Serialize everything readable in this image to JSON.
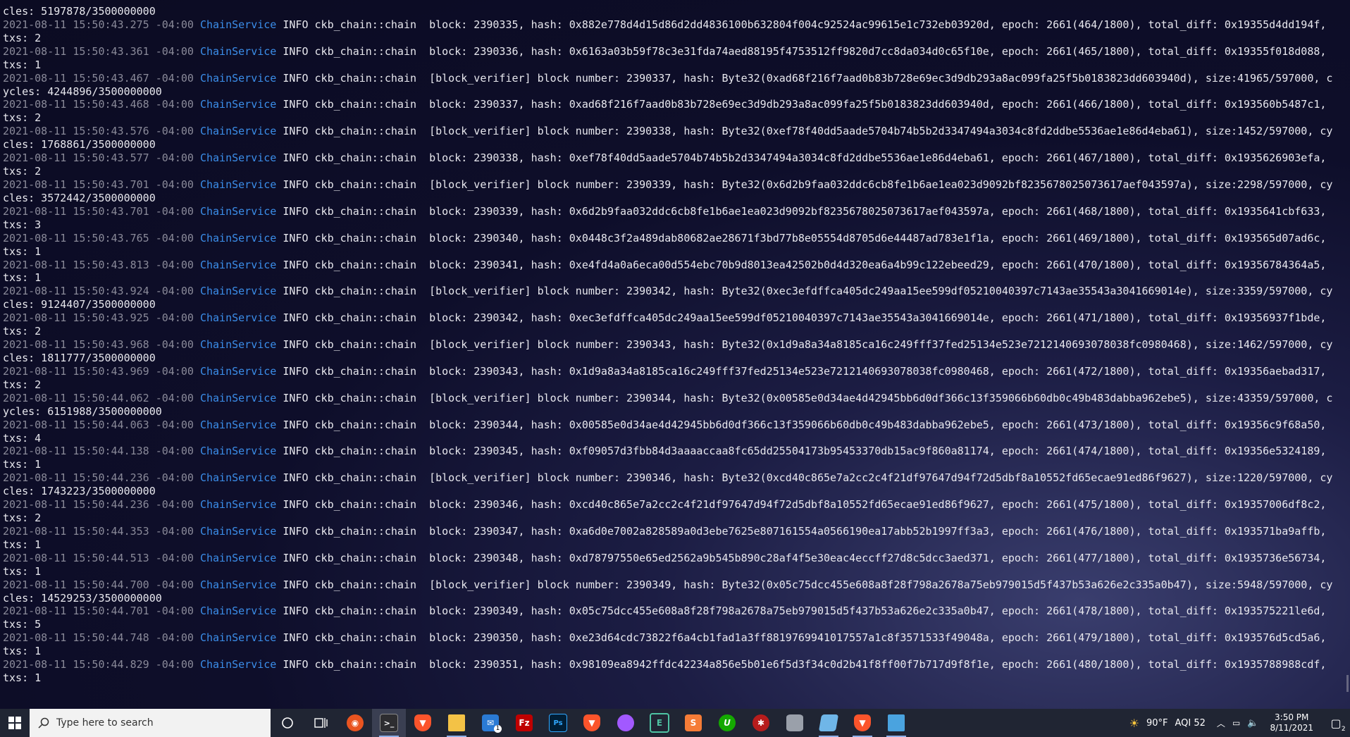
{
  "terminal": {
    "service_name": "ChainService",
    "lines": [
      {
        "text": "cles: 5197878/3500000000"
      },
      {
        "ts": "2021-08-11 15:50:43.275 -04:00",
        "msg": " INFO ckb_chain::chain  block: 2390335, hash: 0x882e778d4d15d86d2dd4836100b632804f004c92524ac99615e1c732eb03920d, epoch: 2661(464/1800), total_diff: 0x19355d4dd194f,"
      },
      {
        "text": "txs: 2"
      },
      {
        "ts": "2021-08-11 15:50:43.361 -04:00",
        "msg": " INFO ckb_chain::chain  block: 2390336, hash: 0x6163a03b59f78c3e31fda74aed88195f4753512ff9820d7cc8da034d0c65f10e, epoch: 2661(465/1800), total_diff: 0x19355f018d088,"
      },
      {
        "text": "txs: 1"
      },
      {
        "ts": "2021-08-11 15:50:43.467 -04:00",
        "msg": " INFO ckb_chain::chain  [block_verifier] block number: 2390337, hash: Byte32(0xad68f216f7aad0b83b728e69ec3d9db293a8ac099fa25f5b0183823dd603940d), size:41965/597000, c"
      },
      {
        "text": "ycles: 4244896/3500000000"
      },
      {
        "ts": "2021-08-11 15:50:43.468 -04:00",
        "msg": " INFO ckb_chain::chain  block: 2390337, hash: 0xad68f216f7aad0b83b728e69ec3d9db293a8ac099fa25f5b0183823dd603940d, epoch: 2661(466/1800), total_diff: 0x193560b5487c1,"
      },
      {
        "text": "txs: 2"
      },
      {
        "ts": "2021-08-11 15:50:43.576 -04:00",
        "msg": " INFO ckb_chain::chain  [block_verifier] block number: 2390338, hash: Byte32(0xef78f40dd5aade5704b74b5b2d3347494a3034c8fd2ddbe5536ae1e86d4eba61), size:1452/597000, cy"
      },
      {
        "text": "cles: 1768861/3500000000"
      },
      {
        "ts": "2021-08-11 15:50:43.577 -04:00",
        "msg": " INFO ckb_chain::chain  block: 2390338, hash: 0xef78f40dd5aade5704b74b5b2d3347494a3034c8fd2ddbe5536ae1e86d4eba61, epoch: 2661(467/1800), total_diff: 0x1935626903efa,"
      },
      {
        "text": "txs: 2"
      },
      {
        "ts": "2021-08-11 15:50:43.701 -04:00",
        "msg": " INFO ckb_chain::chain  [block_verifier] block number: 2390339, hash: Byte32(0x6d2b9faa032ddc6cb8fe1b6ae1ea023d9092bf8235678025073617aef043597a), size:2298/597000, cy"
      },
      {
        "text": "cles: 3572442/3500000000"
      },
      {
        "ts": "2021-08-11 15:50:43.701 -04:00",
        "msg": " INFO ckb_chain::chain  block: 2390339, hash: 0x6d2b9faa032ddc6cb8fe1b6ae1ea023d9092bf8235678025073617aef043597a, epoch: 2661(468/1800), total_diff: 0x1935641cbf633,"
      },
      {
        "text": "txs: 3"
      },
      {
        "ts": "2021-08-11 15:50:43.765 -04:00",
        "msg": " INFO ckb_chain::chain  block: 2390340, hash: 0x0448c3f2a489dab80682ae28671f3bd77b8e05554d8705d6e44487ad783e1f1a, epoch: 2661(469/1800), total_diff: 0x193565d07ad6c,"
      },
      {
        "text": "txs: 1"
      },
      {
        "ts": "2021-08-11 15:50:43.813 -04:00",
        "msg": " INFO ckb_chain::chain  block: 2390341, hash: 0xe4fd4a0a6eca00d554ebc70b9d8013ea42502b0d4d320ea6a4b99c122ebeed29, epoch: 2661(470/1800), total_diff: 0x19356784364a5,"
      },
      {
        "text": "txs: 1"
      },
      {
        "ts": "2021-08-11 15:50:43.924 -04:00",
        "msg": " INFO ckb_chain::chain  [block_verifier] block number: 2390342, hash: Byte32(0xec3efdffca405dc249aa15ee599df05210040397c7143ae35543a3041669014e), size:3359/597000, cy"
      },
      {
        "text": "cles: 9124407/3500000000"
      },
      {
        "ts": "2021-08-11 15:50:43.925 -04:00",
        "msg": " INFO ckb_chain::chain  block: 2390342, hash: 0xec3efdffca405dc249aa15ee599df05210040397c7143ae35543a3041669014e, epoch: 2661(471/1800), total_diff: 0x19356937f1bde,"
      },
      {
        "text": "txs: 2"
      },
      {
        "ts": "2021-08-11 15:50:43.968 -04:00",
        "msg": " INFO ckb_chain::chain  [block_verifier] block number: 2390343, hash: Byte32(0x1d9a8a34a8185ca16c249fff37fed25134e523e7212140693078038fc0980468), size:1462/597000, cy"
      },
      {
        "text": "cles: 1811777/3500000000"
      },
      {
        "ts": "2021-08-11 15:50:43.969 -04:00",
        "msg": " INFO ckb_chain::chain  block: 2390343, hash: 0x1d9a8a34a8185ca16c249fff37fed25134e523e7212140693078038fc0980468, epoch: 2661(472/1800), total_diff: 0x19356aebad317,"
      },
      {
        "text": "txs: 2"
      },
      {
        "ts": "2021-08-11 15:50:44.062 -04:00",
        "msg": " INFO ckb_chain::chain  [block_verifier] block number: 2390344, hash: Byte32(0x00585e0d34ae4d42945bb6d0df366c13f359066b60db0c49b483dabba962ebe5), size:43359/597000, c"
      },
      {
        "text": "ycles: 6151988/3500000000"
      },
      {
        "ts": "2021-08-11 15:50:44.063 -04:00",
        "msg": " INFO ckb_chain::chain  block: 2390344, hash: 0x00585e0d34ae4d42945bb6d0df366c13f359066b60db0c49b483dabba962ebe5, epoch: 2661(473/1800), total_diff: 0x19356c9f68a50,"
      },
      {
        "text": "txs: 4"
      },
      {
        "ts": "2021-08-11 15:50:44.138 -04:00",
        "msg": " INFO ckb_chain::chain  block: 2390345, hash: 0xf09057d3fbb84d3aaaaccaa8fc65dd25504173b95453370db15ac9f860a81174, epoch: 2661(474/1800), total_diff: 0x19356e5324189,"
      },
      {
        "text": "txs: 1"
      },
      {
        "ts": "2021-08-11 15:50:44.236 -04:00",
        "msg": " INFO ckb_chain::chain  [block_verifier] block number: 2390346, hash: Byte32(0xcd40c865e7a2cc2c4f21df97647d94f72d5dbf8a10552fd65ecae91ed86f9627), size:1220/597000, cy"
      },
      {
        "text": "cles: 1743223/3500000000"
      },
      {
        "ts": "2021-08-11 15:50:44.236 -04:00",
        "msg": " INFO ckb_chain::chain  block: 2390346, hash: 0xcd40c865e7a2cc2c4f21df97647d94f72d5dbf8a10552fd65ecae91ed86f9627, epoch: 2661(475/1800), total_diff: 0x19357006df8c2,"
      },
      {
        "text": "txs: 2"
      },
      {
        "ts": "2021-08-11 15:50:44.353 -04:00",
        "msg": " INFO ckb_chain::chain  block: 2390347, hash: 0xa6d0e7002a828589a0d3ebe7625e807161554a0566190ea17abb52b1997ff3a3, epoch: 2661(476/1800), total_diff: 0x193571ba9affb,"
      },
      {
        "text": "txs: 1"
      },
      {
        "ts": "2021-08-11 15:50:44.513 -04:00",
        "msg": " INFO ckb_chain::chain  block: 2390348, hash: 0xd78797550e65ed2562a9b545b890c28af4f5e30eac4eccff27d8c5dcc3aed371, epoch: 2661(477/1800), total_diff: 0x1935736e56734,"
      },
      {
        "text": "txs: 1"
      },
      {
        "ts": "2021-08-11 15:50:44.700 -04:00",
        "msg": " INFO ckb_chain::chain  [block_verifier] block number: 2390349, hash: Byte32(0x05c75dcc455e608a8f28f798a2678a75eb979015d5f437b53a626e2c335a0b47), size:5948/597000, cy"
      },
      {
        "text": "cles: 14529253/3500000000"
      },
      {
        "ts": "2021-08-11 15:50:44.701 -04:00",
        "msg": " INFO ckb_chain::chain  block: 2390349, hash: 0x05c75dcc455e608a8f28f798a2678a75eb979015d5f437b53a626e2c335a0b47, epoch: 2661(478/1800), total_diff: 0x193575221le6d,"
      },
      {
        "text": "txs: 5"
      },
      {
        "ts": "2021-08-11 15:50:44.748 -04:00",
        "msg": " INFO ckb_chain::chain  block: 2390350, hash: 0xe23d64cdc73822f6a4cb1fad1a3ff8819769941017557a1c8f3571533f49048a, epoch: 2661(479/1800), total_diff: 0x193576d5cd5a6,"
      },
      {
        "text": "txs: 1"
      },
      {
        "ts": "2021-08-11 15:50:44.829 -04:00",
        "msg": " INFO ckb_chain::chain  block: 2390351, hash: 0x98109ea8942ffdc42234a856e5b01e6f5d3f34c0d2b41f8ff00f7b717d9f8f1e, epoch: 2661(480/1800), total_diff: 0x1935788988cdf,"
      },
      {
        "text": "txs: 1"
      }
    ]
  },
  "taskbar": {
    "search_placeholder": "Type here to search",
    "mail_badge": "1",
    "weather": "90°F",
    "aqi": "AQI 52",
    "time": "3:50 PM",
    "date": "8/11/2021",
    "notification_count": "2"
  },
  "colors": {
    "service": "#3b8eea",
    "timestamp": "#8a8a99",
    "text": "#e8e8ee",
    "taskbar": "#202533"
  }
}
